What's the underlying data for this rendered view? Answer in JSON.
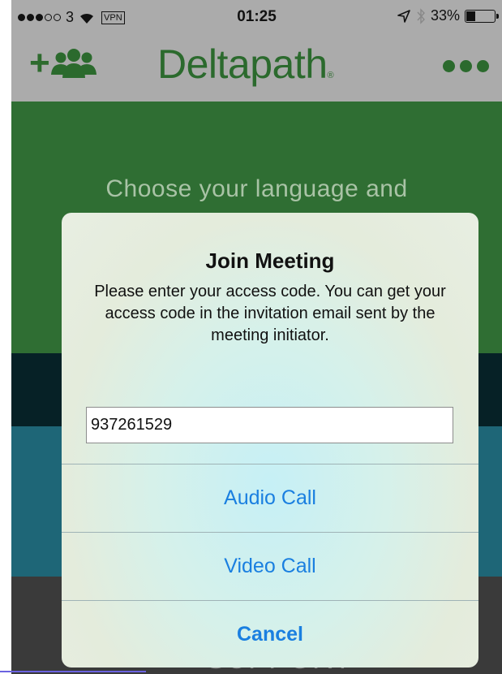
{
  "statusbar": {
    "carrier": "3",
    "vpn": "VPN",
    "time": "01:25",
    "battery": "33%",
    "battery_level": 0.33
  },
  "navbar": {
    "add_label": "+",
    "logo": "Deltapath",
    "logo_mark": "®",
    "accent_color": "#2b6a2d"
  },
  "background": {
    "choose_text": "Choose your language and",
    "bottom_text": "SUPPORT"
  },
  "alert": {
    "title": "Join Meeting",
    "message": "Please enter your access code. You can get your access code in the invitation email sent by the meeting initiator.",
    "access_code": "937261529",
    "buttons": {
      "audio": "Audio Call",
      "video": "Video Call",
      "cancel": "Cancel"
    },
    "button_color": "#1a7fe0"
  }
}
